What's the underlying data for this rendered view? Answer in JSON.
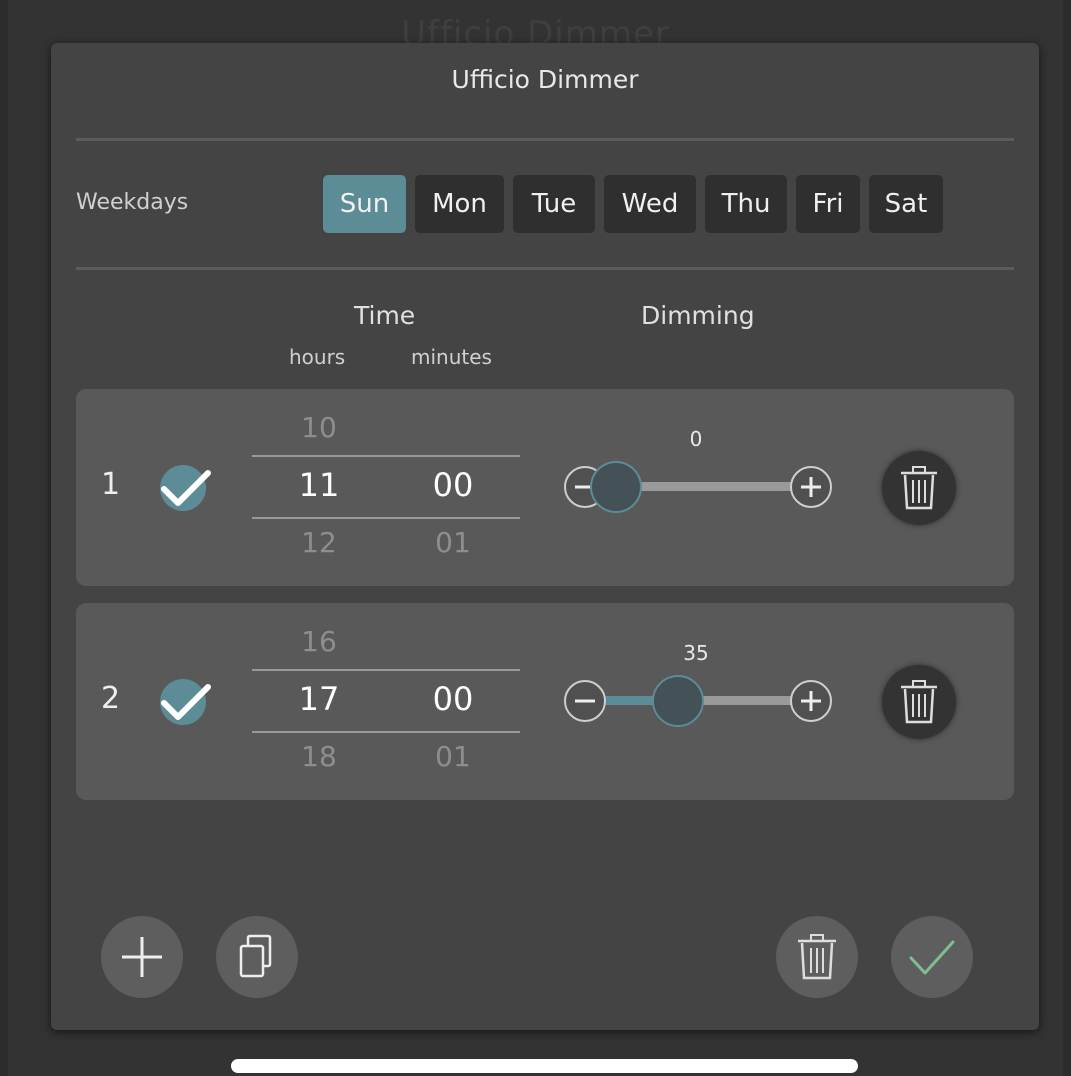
{
  "background_title": "Ufficio Dimmer",
  "dialog": {
    "title": "Ufficio Dimmer",
    "weekdays_label": "Weekdays",
    "days": [
      {
        "label": "Sun",
        "selected": true
      },
      {
        "label": "Mon",
        "selected": false
      },
      {
        "label": "Tue",
        "selected": false
      },
      {
        "label": "Wed",
        "selected": false
      },
      {
        "label": "Thu",
        "selected": false
      },
      {
        "label": "Fri",
        "selected": false
      },
      {
        "label": "Sat",
        "selected": false
      }
    ],
    "headers": {
      "time": "Time",
      "dimming": "Dimming",
      "hours": "hours",
      "minutes": "minutes"
    },
    "rows": [
      {
        "number": "1",
        "enabled": true,
        "hours_prev": "10",
        "hours": "11",
        "hours_next": "12",
        "minutes": "00",
        "minutes_next": "01",
        "dimming": "0",
        "dimming_fraction": 0.0
      },
      {
        "number": "2",
        "enabled": true,
        "hours_prev": "16",
        "hours": "17",
        "hours_next": "18",
        "minutes": "00",
        "minutes_next": "01",
        "dimming": "35",
        "dimming_fraction": 0.35
      }
    ]
  },
  "colors": {
    "accent": "#5c8c96",
    "confirm_check": "#7fbf8f",
    "dialog_bg": "#444444",
    "row_bg": "#595959"
  },
  "icons": {
    "add": "plus-icon",
    "copy": "copy-icon",
    "delete": "trash-icon",
    "confirm": "checkmark-icon",
    "minus": "minus-icon",
    "plus": "plus-icon"
  }
}
